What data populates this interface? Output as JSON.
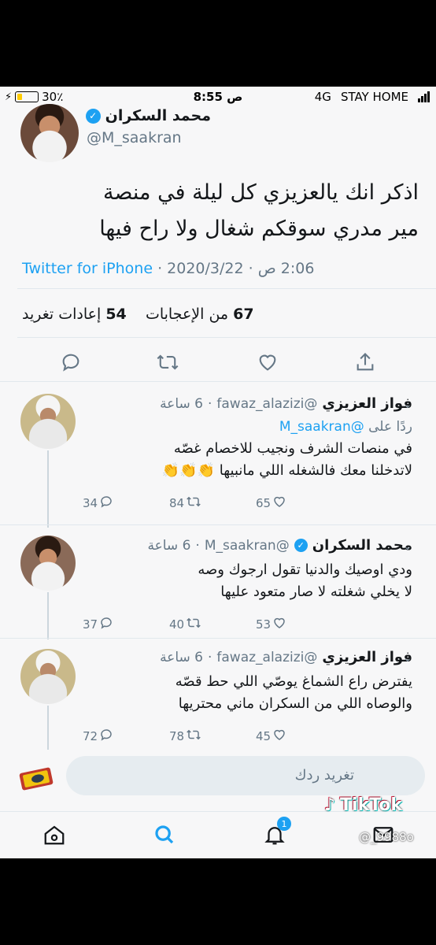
{
  "status": {
    "battery": "30٪",
    "time": "8:55",
    "ampm": "ص",
    "network": "4G",
    "carrier": "STAY HOME"
  },
  "main_tweet": {
    "name": "محمد السكران",
    "handle": "@M_saakran",
    "line1": "اذكر انك يالعزيزي كل ليلة في منصة",
    "line2": "مير مدري سوقكم شغال ولا راح فيها",
    "time": "2:06 ص",
    "date": "2020/3/22",
    "source": "Twitter for iPhone",
    "likes_count": "67",
    "likes_label": "من الإعجابات",
    "retweets_count": "54",
    "retweets_label": "إعادات تغريد"
  },
  "replies": [
    {
      "name": "فواز العزيزي",
      "handle": "@fawaz_alazizi",
      "time": "6 ساعة",
      "replying_label": "ردًا على",
      "replying_to": "@M_saakran",
      "line1": "في منصات الشرف ونجيب للاخصام غصّه",
      "line2": "لاتدخلنا معك فالشغله اللي مانبيها 👏👏👏",
      "replies": "34",
      "retweets": "84",
      "likes": "65"
    },
    {
      "name": "محمد السكران",
      "handle": "@M_saakran",
      "time": "6 ساعة",
      "line1": "ودي اوصيك والدنيا تقول ارجوك وصه",
      "line2": "لا يخلي شغلته لا صار متعود عليها",
      "replies": "37",
      "retweets": "40",
      "likes": "53"
    },
    {
      "name": "فواز العزيزي",
      "handle": "@fawaz_alazizi",
      "time": "6 ساعة",
      "line1": "يفترض راع الشماغ يوصّي اللي حط قصّه",
      "line2": "والوصاه اللي من السكران ماني محتريها",
      "replies": "72",
      "retweets": "78",
      "likes": "45"
    }
  ],
  "compose": {
    "placeholder": "تغريد ردك"
  },
  "tabbar": {
    "notifications_badge": "1"
  },
  "watermark": {
    "brand": "TikTok",
    "user": "@_9988o"
  },
  "colors": {
    "accent": "#1da1f2",
    "text": "#14171a",
    "muted": "#657786"
  },
  "icons": [
    "reply-icon",
    "retweet-icon",
    "like-icon",
    "share-icon",
    "home-icon",
    "search-icon",
    "notifications-icon",
    "messages-icon",
    "verified-icon"
  ]
}
